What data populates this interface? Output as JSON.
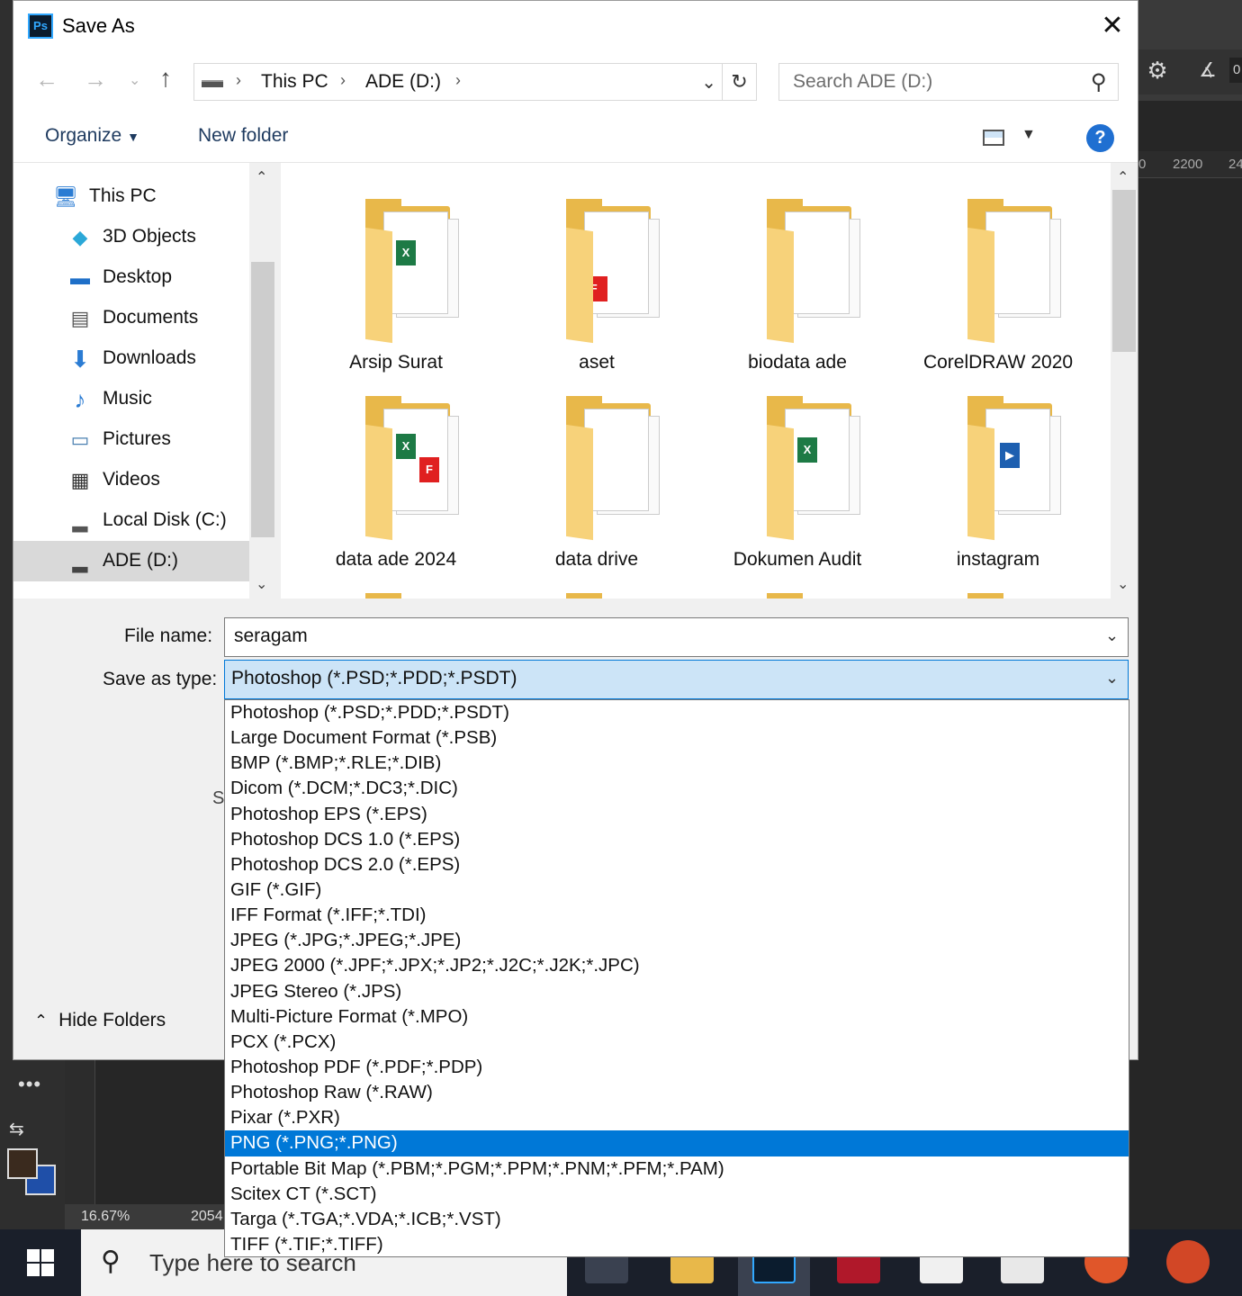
{
  "window": {
    "title": "Save As",
    "app_icon_text": "Ps"
  },
  "ps_bg": {
    "ruler_labels": [
      "0",
      "2200",
      "24"
    ],
    "zoom": "16.67%",
    "doc_dim": "2054",
    "field_text": "0"
  },
  "nav": {
    "crumbs": [
      "This PC",
      "ADE (D:)"
    ],
    "search_placeholder": "Search ADE (D:)"
  },
  "toolbar": {
    "organize": "Organize",
    "new_folder": "New folder",
    "help": "?"
  },
  "sidebar": {
    "items": [
      {
        "label": "This PC",
        "icon": "computer-icon"
      },
      {
        "label": "3D Objects",
        "icon": "cube-icon"
      },
      {
        "label": "Desktop",
        "icon": "desktop-icon"
      },
      {
        "label": "Documents",
        "icon": "document-icon"
      },
      {
        "label": "Downloads",
        "icon": "download-arrow-icon"
      },
      {
        "label": "Music",
        "icon": "music-note-icon"
      },
      {
        "label": "Pictures",
        "icon": "picture-icon"
      },
      {
        "label": "Videos",
        "icon": "film-icon"
      },
      {
        "label": "Local Disk (C:)",
        "icon": "drive-icon"
      },
      {
        "label": "ADE (D:)",
        "icon": "drive-icon",
        "selected": true
      }
    ]
  },
  "files": [
    {
      "name": "Arsip Surat"
    },
    {
      "name": "aset"
    },
    {
      "name": "biodata ade"
    },
    {
      "name": "CorelDRAW 2020"
    },
    {
      "name": "data ade 2024"
    },
    {
      "name": "data drive"
    },
    {
      "name": "Dokumen Audit"
    },
    {
      "name": "instagram"
    }
  ],
  "form": {
    "filename_label": "File name:",
    "filename_value": "seragam",
    "type_label": "Save as type:",
    "type_value": "Photoshop (*.PSD;*.PDD;*.PSDT)",
    "hidden_letter": "S"
  },
  "hide_folders": "Hide Folders",
  "type_options": [
    "Photoshop (*.PSD;*.PDD;*.PSDT)",
    "Large Document Format (*.PSB)",
    "BMP (*.BMP;*.RLE;*.DIB)",
    "Dicom (*.DCM;*.DC3;*.DIC)",
    "Photoshop EPS (*.EPS)",
    "Photoshop DCS 1.0 (*.EPS)",
    "Photoshop DCS 2.0 (*.EPS)",
    "GIF (*.GIF)",
    "IFF Format (*.IFF;*.TDI)",
    "JPEG (*.JPG;*.JPEG;*.JPE)",
    "JPEG 2000 (*.JPF;*.JPX;*.JP2;*.J2C;*.J2K;*.JPC)",
    "JPEG Stereo (*.JPS)",
    "Multi-Picture Format (*.MPO)",
    "PCX (*.PCX)",
    "Photoshop PDF (*.PDF;*.PDP)",
    "Photoshop Raw (*.RAW)",
    "Pixar (*.PXR)",
    "PNG (*.PNG;*.PNG)",
    "Portable Bit Map (*.PBM;*.PGM;*.PPM;*.PNM;*.PFM;*.PAM)",
    "Scitex CT (*.SCT)",
    "Targa (*.TGA;*.VDA;*.ICB;*.VST)",
    "TIFF (*.TIF;*.TIFF)"
  ],
  "type_selected_index": 17,
  "taskbar": {
    "search_placeholder": "Type here to search"
  },
  "colors": {
    "accent": "#0078d7",
    "select_bg": "#cce4f7",
    "folder": "#e8b84a"
  }
}
